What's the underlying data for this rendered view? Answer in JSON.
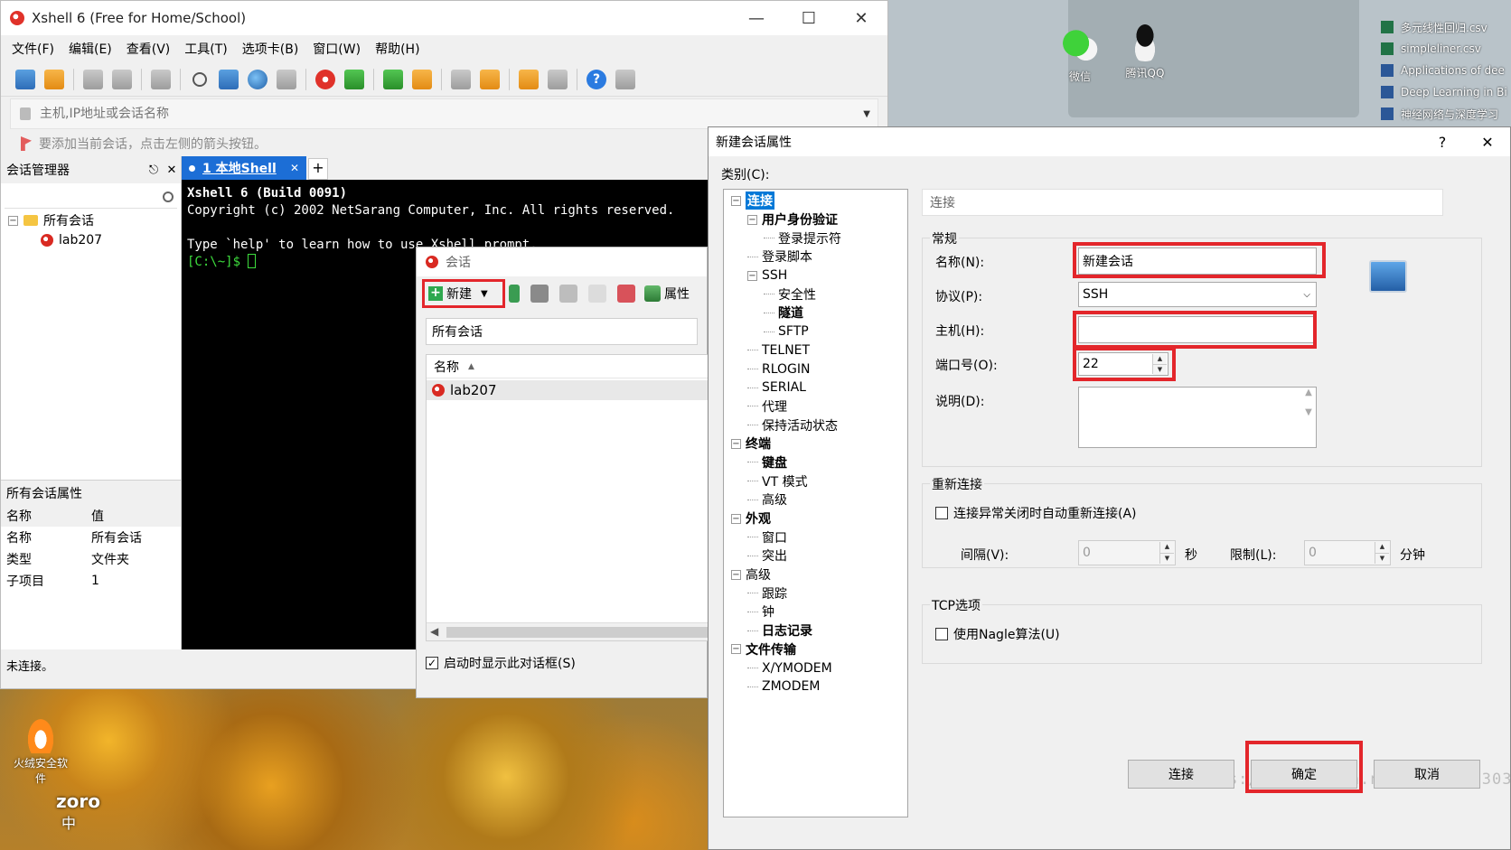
{
  "desktop": {
    "wechat_label": "微信",
    "qq_label": "腾讯QQ",
    "files": [
      {
        "name": "多元线性回归.csv",
        "type": "xls"
      },
      {
        "name": "simpleliner.csv",
        "type": "xls"
      },
      {
        "name": "Applications of dee",
        "type": "doc"
      },
      {
        "name": "Deep Learning in Bi",
        "type": "doc"
      },
      {
        "name": "神经网络与深度学习",
        "type": "doc"
      }
    ],
    "fire_label": "火绒安全软件",
    "zoro_label": "zoro",
    "ime_label": "中"
  },
  "xshell": {
    "title": "Xshell 6 (Free for Home/School)",
    "menus": [
      "文件(F)",
      "编辑(E)",
      "查看(V)",
      "工具(T)",
      "选项卡(B)",
      "窗口(W)",
      "帮助(H)"
    ],
    "address_placeholder": "主机,IP地址或会话名称",
    "tip": "要添加当前会话，点击左侧的箭头按钮。",
    "status": "未连接。"
  },
  "session_manager": {
    "title": "会话管理器",
    "tree": {
      "root": "所有会话",
      "child": "lab207"
    },
    "props_title": "所有会话属性",
    "props_head": {
      "k": "名称",
      "v": "值"
    },
    "props": [
      {
        "k": "名称",
        "v": "所有会话"
      },
      {
        "k": "类型",
        "v": "文件夹"
      },
      {
        "k": "子项目",
        "v": "1"
      }
    ]
  },
  "tabs": {
    "active": "1 本地Shell",
    "add": "+"
  },
  "terminal": {
    "line1": "Xshell 6 (Build 0091)",
    "line2": "Copyright (c) 2002 NetSarang Computer, Inc. All rights reserved.",
    "line3": "Type `help' to learn how to use Xshell prompt.",
    "prompt": "[C:\\~]$ "
  },
  "sessions_dialog": {
    "title": "会话",
    "new_label": "新建",
    "props_label": "属性",
    "path": "所有会话",
    "column_name": "名称",
    "row": "lab207",
    "startup_check": "启动时显示此对话框(S)"
  },
  "props_dialog": {
    "title": "新建会话属性",
    "help": "?",
    "category_label": "类别(C):",
    "categories": [
      {
        "label": "连接",
        "level": 0,
        "toggle": "−",
        "sel": true
      },
      {
        "label": "用户身份验证",
        "level": 1,
        "toggle": "−",
        "bold": true
      },
      {
        "label": "登录提示符",
        "level": 2
      },
      {
        "label": "登录脚本",
        "level": 1
      },
      {
        "label": "SSH",
        "level": 1,
        "toggle": "−"
      },
      {
        "label": "安全性",
        "level": 2
      },
      {
        "label": "隧道",
        "level": 2,
        "bold": true
      },
      {
        "label": "SFTP",
        "level": 2
      },
      {
        "label": "TELNET",
        "level": 1
      },
      {
        "label": "RLOGIN",
        "level": 1
      },
      {
        "label": "SERIAL",
        "level": 1
      },
      {
        "label": "代理",
        "level": 1
      },
      {
        "label": "保持活动状态",
        "level": 1
      },
      {
        "label": "终端",
        "level": 0,
        "toggle": "−",
        "bold": true
      },
      {
        "label": "键盘",
        "level": 1,
        "bold": true
      },
      {
        "label": "VT 模式",
        "level": 1
      },
      {
        "label": "高级",
        "level": 1
      },
      {
        "label": "外观",
        "level": 0,
        "toggle": "−",
        "bold": true
      },
      {
        "label": "窗口",
        "level": 1
      },
      {
        "label": "突出",
        "level": 1
      },
      {
        "label": "高级",
        "level": 0,
        "toggle": "−"
      },
      {
        "label": "跟踪",
        "level": 1
      },
      {
        "label": "钟",
        "level": 1
      },
      {
        "label": "日志记录",
        "level": 1,
        "bold": true
      },
      {
        "label": "文件传输",
        "level": 0,
        "toggle": "−",
        "bold": true
      },
      {
        "label": "X/YMODEM",
        "level": 1
      },
      {
        "label": "ZMODEM",
        "level": 1
      }
    ],
    "section_header": "连接",
    "general": {
      "title": "常规",
      "name_label": "名称(N):",
      "name_value": "新建会话",
      "protocol_label": "协议(P):",
      "protocol_value": "SSH",
      "host_label": "主机(H):",
      "host_value": "",
      "port_label": "端口号(O):",
      "port_value": "22",
      "desc_label": "说明(D):"
    },
    "reconnect": {
      "title": "重新连接",
      "auto_label": "连接异常关闭时自动重新连接(A)",
      "interval_label": "间隔(V):",
      "interval_value": "0",
      "sec": "秒",
      "limit_label": "限制(L):",
      "limit_value": "0",
      "min": "分钟"
    },
    "tcp": {
      "title": "TCP选项",
      "nagle_label": "使用Nagle算法(U)"
    },
    "buttons": {
      "connect": "连接",
      "ok": "确定",
      "cancel": "取消"
    },
    "watermark": "https://blog.csdn.net/qq_21933035"
  },
  "colors": {
    "accent": "#1c6ed6",
    "highlight_red": "#e3262b",
    "selection": "#0078d7"
  }
}
